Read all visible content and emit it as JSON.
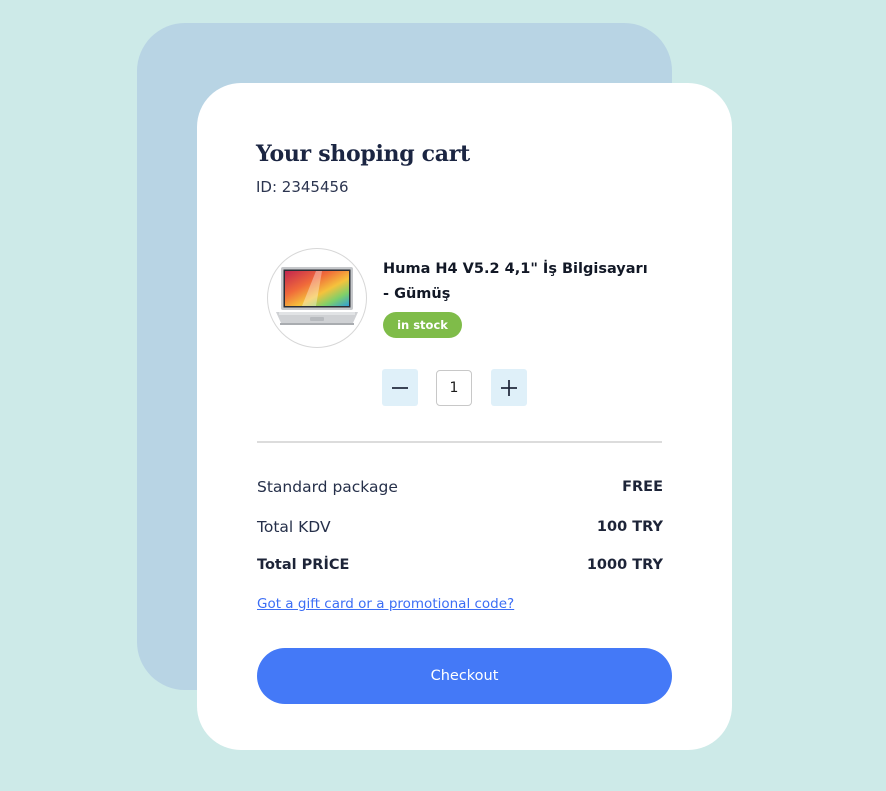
{
  "cart": {
    "title": "Your shoping cart",
    "id_text": "ID: 2345456"
  },
  "product": {
    "name": "Huma H4 V5.2 4,1\" İş Bilgisayarı - Gümüş",
    "stock_status": "in stock",
    "quantity": "1",
    "image_icon": "laptop-icon"
  },
  "summary": {
    "shipping_label": "Standard package",
    "shipping_value": "FREE",
    "tax_label": "Total KDV",
    "tax_value": "100 TRY",
    "total_label": "Total PRİCE",
    "total_value": "1000 TRY"
  },
  "promo": {
    "link_text": "Got a gift card or a promotional code?"
  },
  "checkout": {
    "label": "Checkout"
  },
  "colors": {
    "page_background": "#cdeae8",
    "back_card": "#b8d4e4",
    "card": "#ffffff",
    "stock_badge": "#7fbc49",
    "quantity_button": "#dff0f9",
    "link": "#3c6ef5",
    "checkout_button": "#4479f7"
  }
}
